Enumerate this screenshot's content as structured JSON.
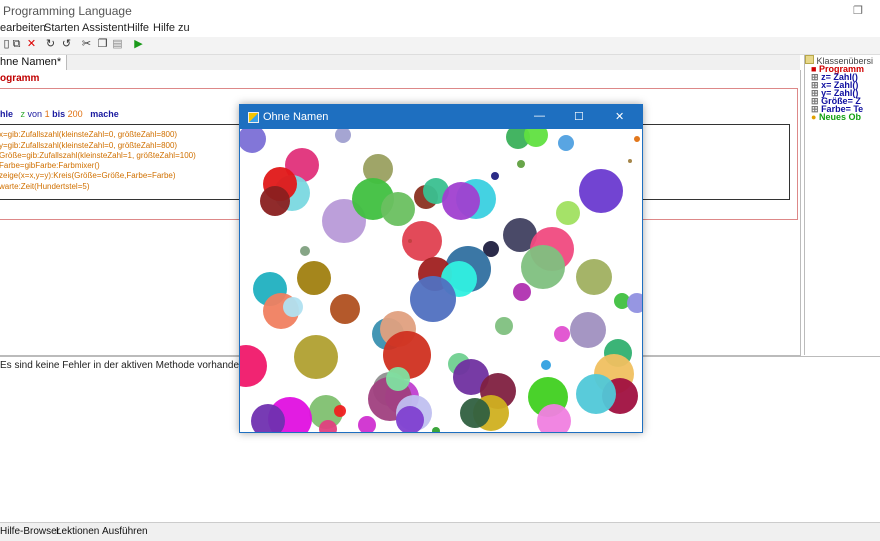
{
  "window": {
    "title": "Programming Language",
    "max_glyph": "❐"
  },
  "menu": [
    "earbeiten",
    "Starten",
    "Assistent",
    "Hilfe",
    "Hilfe zu"
  ],
  "toolbar_icons": [
    "new-icon",
    "copy-icon",
    "delete-icon",
    "redo-icon",
    "undo-icon",
    "cut-icon",
    "copy-icon",
    "paste-icon",
    "run-icon"
  ],
  "editor": {
    "tab_label": "hne Namen*",
    "program_label": "ogramm",
    "loop": {
      "prefix": "hle",
      "var": "z",
      "von": "von",
      "from": "1",
      "bis": "bis",
      "to": "200",
      "mache": "mache"
    },
    "code_lines": [
      "x=gib:Zufallszahl(kleinsteZahl=0, größteZahl=800)",
      "y=gib:Zufallszahl(kleinsteZahl=0, größteZahl=800)",
      "Größe=gib:Zufallszahl(kleinsteZahl=1, größteZahl=100)",
      "Farbe=gibFarbe:Farbmixer()",
      "zeige(x=x,y=y):Kreis(Größe=Größe,Farbe=Farbe)",
      "warte:Zeit(Hundertstel=5)"
    ]
  },
  "class_panel": {
    "header": "Klassenübersi",
    "items": [
      {
        "label": "Programm",
        "color": "#d00000"
      },
      {
        "label": "z= Zahl()",
        "color": "#1010a0"
      },
      {
        "label": "x= Zahl()",
        "color": "#1010a0"
      },
      {
        "label": "y= Zahl()",
        "color": "#1010a0"
      },
      {
        "label": "Größe= Z",
        "color": "#1010a0"
      },
      {
        "label": "Farbe= Te",
        "color": "#1010a0"
      },
      {
        "label": "Neues Ob",
        "color": "#10a010"
      }
    ]
  },
  "status": {
    "message": "Es sind keine Fehler in der aktiven Methode vorhanden."
  },
  "bottom_tabs": [
    "Hilfe-Browser",
    "Lektionen",
    "Ausführen"
  ],
  "output_window": {
    "title": "Ohne Namen",
    "buttons": {
      "minimize": "—",
      "maximize": "☐",
      "close": "✕"
    },
    "circle_count": 200
  }
}
